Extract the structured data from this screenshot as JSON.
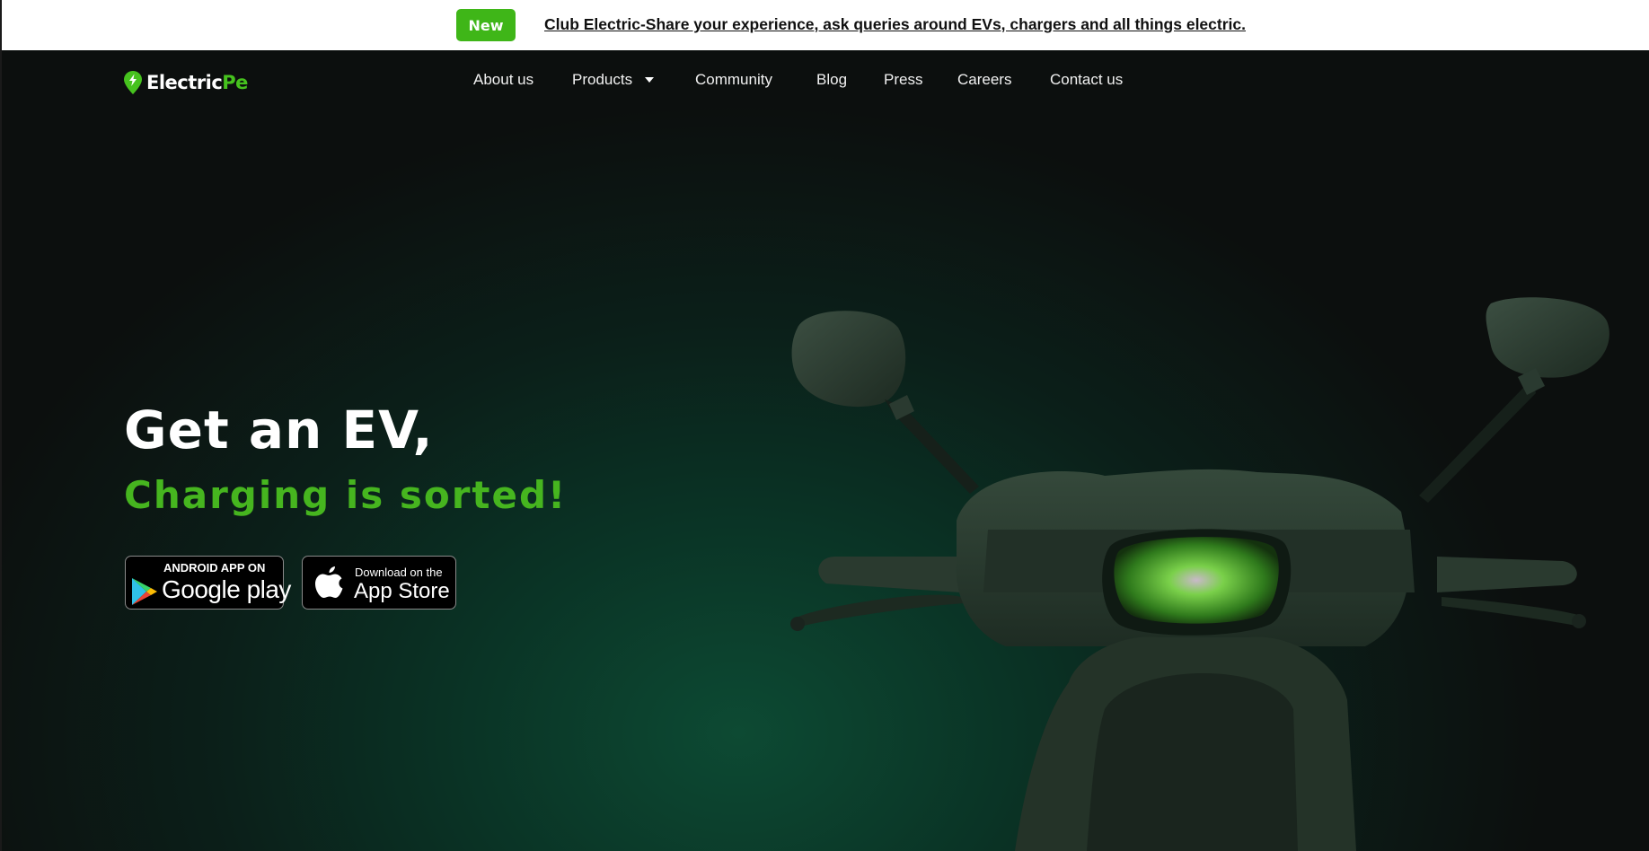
{
  "announcement": {
    "badge": "New",
    "link_text": "Club Electric-Share your experience, ask queries around EVs, chargers and all things electric."
  },
  "brand": {
    "name_part1": "Electric",
    "name_part2": "Pe",
    "logo_icon": "bolt-pin-icon"
  },
  "nav": {
    "items": [
      {
        "label": "About us"
      },
      {
        "label": "Products",
        "icon": "caret-down-icon"
      },
      {
        "label": "Community"
      },
      {
        "label": "Blog"
      },
      {
        "label": "Press"
      },
      {
        "label": "Careers"
      },
      {
        "label": "Contact us"
      }
    ]
  },
  "hero": {
    "headline": "Get an EV,",
    "subheadline": "Charging is sorted!",
    "image": "electric-scooter-front"
  },
  "stores": {
    "google_play": {
      "top": "ANDROID APP ON",
      "main": "Google play",
      "icon": "google-play-icon"
    },
    "app_store": {
      "top": "Download on the",
      "main": "App Store",
      "icon": "apple-icon"
    }
  },
  "colors": {
    "accent": "#46b51f",
    "badge": "#3fb618",
    "background": "#0c0f0e",
    "hero_glow": "#0d4a33"
  }
}
